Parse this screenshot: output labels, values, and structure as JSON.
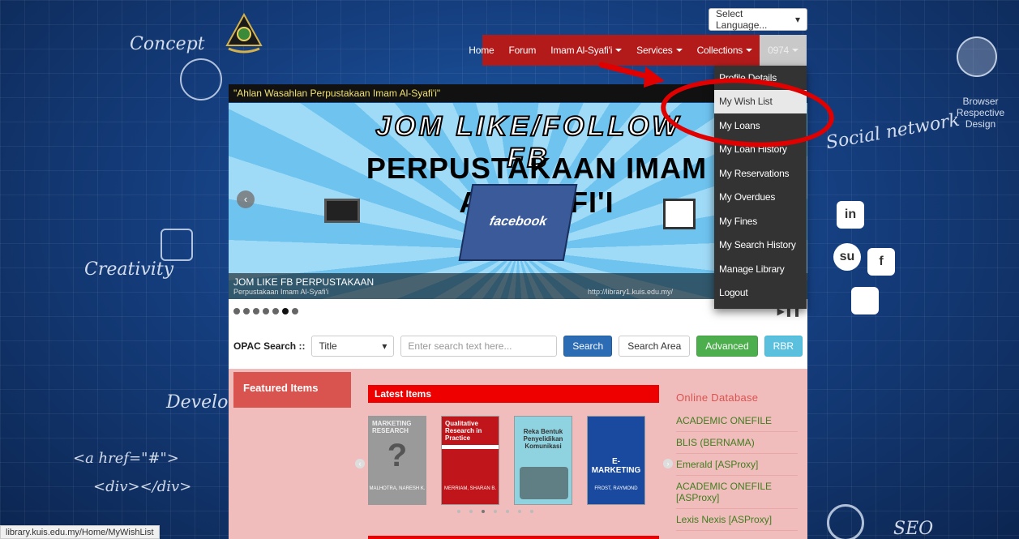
{
  "background": {
    "labels": [
      "Concept",
      "Creativity",
      "Developme",
      "<a href=\"#\">",
      "<div></div>",
      "Social network",
      "Browser Respective Design",
      "SEO"
    ]
  },
  "language_select": {
    "value": "Select Language..."
  },
  "nav": {
    "items": [
      "Home",
      "Forum",
      "Imam Al-Syafi'i",
      "Services",
      "Collections"
    ],
    "user_label": "0974"
  },
  "marquee": {
    "text": "\"Ahlan Wasahlan Perpustakaan Imam Al-Syafi'i\""
  },
  "slider": {
    "headline1": "JOM LIKE/FOLLOW FB",
    "headline2": "PERPUSTAKAAN IMAM AL-SYAFI'I",
    "book_label": "facebook",
    "caption": "JOM LIKE FB PERPUSTAKAAN",
    "caption_sub_left": "Perpustakaan Imam Al-Syafi'i",
    "caption_sub_right": "http://library1.kuis.edu.my/",
    "dots_total": 7,
    "active_dot": 6
  },
  "opac": {
    "label": "OPAC Search ::",
    "field_select": "Title",
    "search_placeholder": "Enter search text here...",
    "search_button": "Search",
    "search_area_button": "Search Area",
    "advanced_button": "Advanced",
    "rbr_button": "RBR"
  },
  "featured": {
    "title": "Featured Items"
  },
  "latest": {
    "title": "Latest Items",
    "books": [
      {
        "title": "MARKETING RESEARCH",
        "author": "MALHOTRA, NARESH K.",
        "color": "#9a9a9a"
      },
      {
        "title": "Qualitative Research in Practice",
        "author": "MERRIAM, SHARAN B.",
        "color": "#c0161b"
      },
      {
        "title": "Reka Bentuk Penyelidikan Komunikasi",
        "author": "",
        "color": "#8fd3e0"
      },
      {
        "title": "E-MARKETING",
        "author": "FROST, RAYMOND",
        "color": "#1a4aa0"
      }
    ]
  },
  "online_db": {
    "title": "Online Database",
    "links": [
      "ACADEMIC ONEFILE",
      "BLIS (BERNAMA)",
      "Emerald [ASProxy]",
      "ACADEMIC ONEFILE [ASProxy]",
      "Lexis Nexis [ASProxy]"
    ]
  },
  "dropdown": {
    "items": [
      "Profile Details",
      "My Wish List",
      "My Loans",
      "My Loan History",
      "My Reservations",
      "My Overdues",
      "My Fines",
      "My Search History",
      "Manage Library",
      "Logout"
    ],
    "highlighted": "My Wish List"
  },
  "statusbar": {
    "url": "library.kuis.edu.my/Home/MyWishList"
  },
  "colors": {
    "nav_red": "#b31b1b",
    "annotation_red": "#e00000",
    "dropdown_bg": "#333333"
  }
}
